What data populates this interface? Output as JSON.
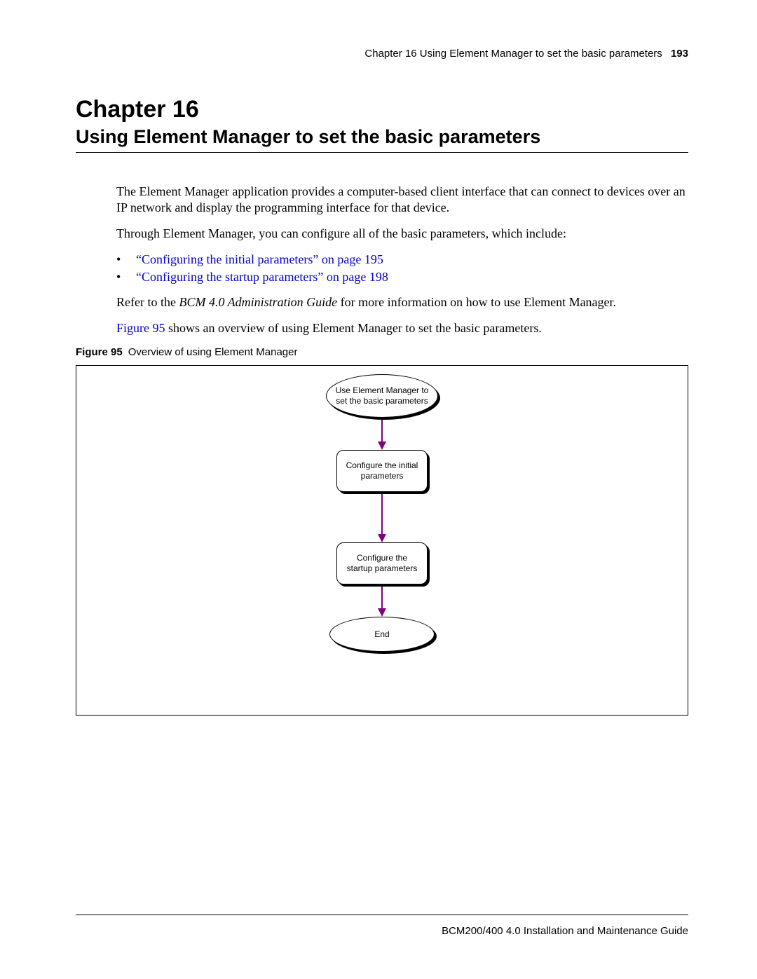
{
  "header": {
    "chapter_ref": "Chapter 16  Using Element Manager to set the basic parameters",
    "page_number": "193"
  },
  "title": {
    "chapter": "Chapter 16",
    "heading": "Using Element Manager to set the basic parameters"
  },
  "paragraphs": {
    "p1": "The Element Manager application provides a computer-based client interface that can connect to devices over an IP network and display the programming interface for that device.",
    "p2": "Through Element Manager, you can configure all of the basic parameters, which include:",
    "p3_prefix": "Refer to the ",
    "p3_italic": "BCM 4.0 Administration Guide",
    "p3_suffix": " for more information on how to use Element Manager.",
    "p4_link": "Figure 95",
    "p4_suffix": " shows an overview of using Element Manager to set the basic parameters."
  },
  "bullets": {
    "b1": "“Configuring the initial parameters” on page 195",
    "b2": "“Configuring the startup parameters” on page 198",
    "dot": "•"
  },
  "figure": {
    "label": "Figure 95",
    "caption": "Overview of using Element Manager",
    "nodes": {
      "start": "Use Element Manager to set the basic parameters",
      "step1": "Configure the initial parameters",
      "step2": "Configure the startup parameters",
      "end": "End"
    }
  },
  "footer": {
    "text": "BCM200/400 4.0 Installation and Maintenance Guide"
  }
}
